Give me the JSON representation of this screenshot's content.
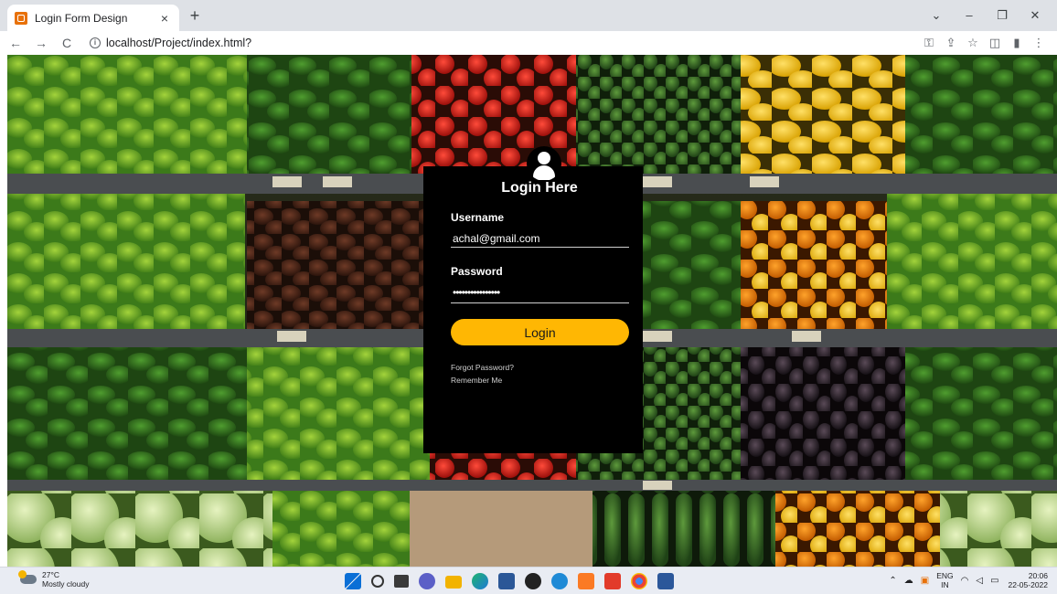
{
  "browser": {
    "tab_title": "Login Form Design",
    "tab_close": "×",
    "new_tab": "+",
    "back": "←",
    "forward": "→",
    "reload": "C",
    "url": "localhost/Project/index.html?",
    "window_controls": {
      "collapse": "⌄",
      "minimize": "–",
      "restore": "❐",
      "close": "✕"
    },
    "toolbar_icons": [
      "key-icon",
      "share-icon",
      "star-icon",
      "sidepanel-icon",
      "profile-icon",
      "menu-icon"
    ]
  },
  "login": {
    "title": "Login Here",
    "username_label": "Username",
    "username_value": "achal@gmail.com",
    "password_label": "Password",
    "password_value": "••••••••••••••••",
    "login_button": "Login",
    "forgot_password": "Forgot Password?",
    "remember_me": "Remember Me",
    "accent_color": "#ffb703"
  },
  "taskbar": {
    "temperature": "27°C",
    "weather": "Mostly cloudy",
    "lang_top": "ENG",
    "lang_bottom": "IN",
    "time": "20:06",
    "date": "22-05-2022"
  }
}
